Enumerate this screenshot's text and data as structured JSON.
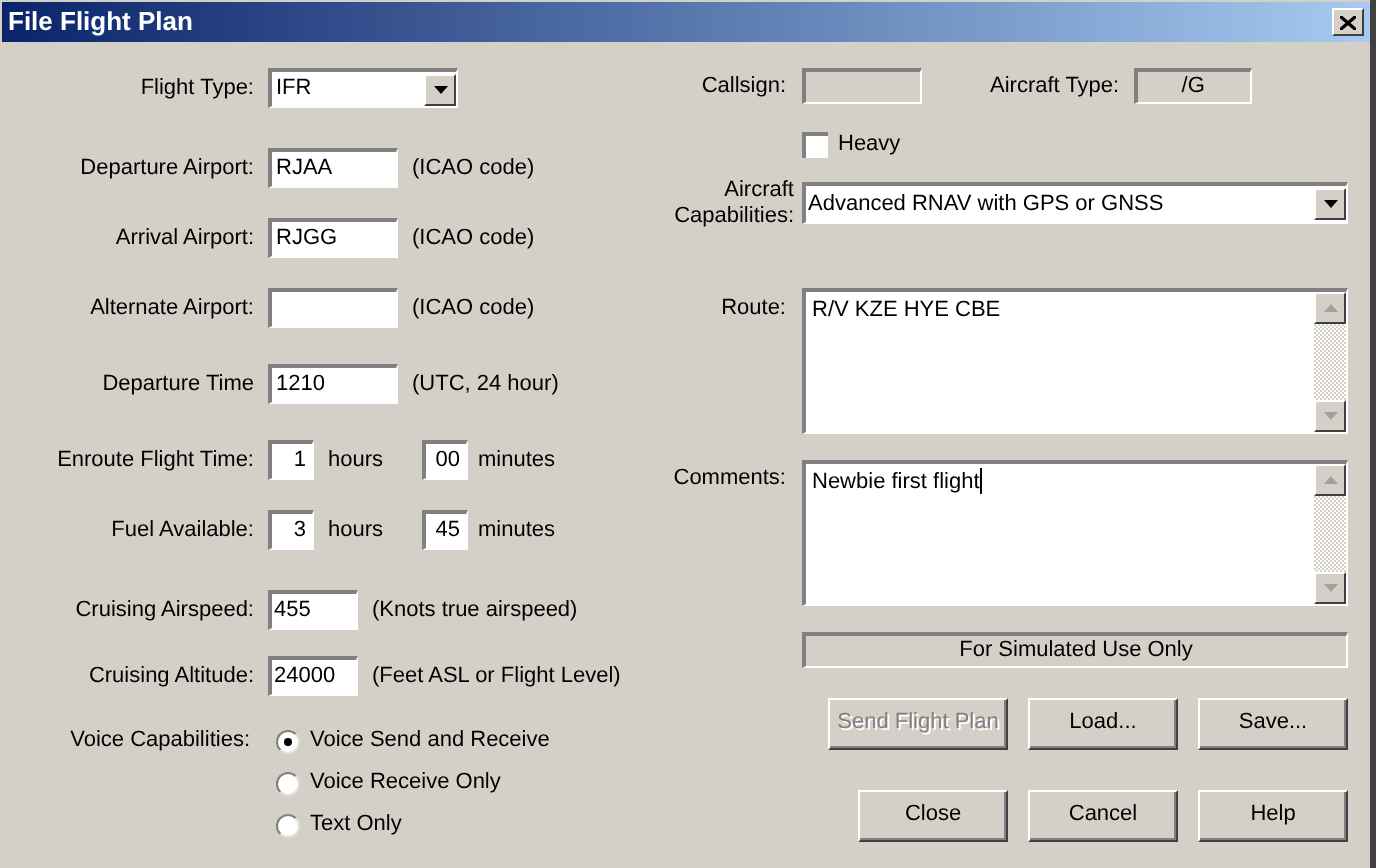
{
  "window": {
    "title": "File Flight Plan"
  },
  "left_fields": [
    {
      "kind": "select",
      "label": "Flight Type:",
      "value": "IFR"
    },
    {
      "kind": "text",
      "label": "Departure Airport:",
      "value": "RJAA",
      "hint": "(ICAO code)"
    },
    {
      "kind": "text",
      "label": "Arrival Airport:",
      "value": "RJGG",
      "hint": "(ICAO code)"
    },
    {
      "kind": "text",
      "label": "Alternate Airport:",
      "hint": "(ICAO code)"
    },
    {
      "kind": "text",
      "label": "Departure Time",
      "value": "1210",
      "hint": "(UTC, 24 hour)"
    },
    {
      "kind": "duration",
      "label": "Enroute Flight Time:",
      "hours": "1",
      "hours_unit": "hours",
      "minutes": "00",
      "minutes_unit": "minutes"
    },
    {
      "kind": "duration",
      "label": "Fuel Available:",
      "hours": "3",
      "hours_unit": "hours",
      "minutes": "45",
      "minutes_unit": "minutes"
    },
    {
      "kind": "short",
      "label": "Cruising Airspeed:",
      "value": "455",
      "hint": "(Knots true airspeed)"
    },
    {
      "kind": "short",
      "label": "Cruising Altitude:",
      "value": "24000",
      "hint": "(Feet ASL or Flight Level)"
    }
  ],
  "voice": {
    "label": "Voice Capabilities:",
    "options": [
      {
        "label": "Voice Send and Receive",
        "selected": true
      },
      {
        "label": "Voice Receive Only",
        "selected": false
      },
      {
        "label": "Text Only",
        "selected": false
      }
    ]
  },
  "callsign": {
    "label": "Callsign:"
  },
  "aircraft_type": {
    "label": "Aircraft Type:",
    "value": "/G"
  },
  "heavy": {
    "label": "Heavy",
    "checked": false
  },
  "capabilities": {
    "label_lines": [
      "Aircraft",
      "Capabilities:"
    ],
    "value": "Advanced RNAV with GPS or GNSS"
  },
  "route": {
    "label": "Route:",
    "value": "R/V KZE HYE CBE"
  },
  "comments": {
    "label": "Comments:",
    "value": "Newbie first flight",
    "caret": true
  },
  "notice": "For Simulated Use Only",
  "button_rows": [
    [
      {
        "label": "Send Flight Plan",
        "disabled": true
      },
      {
        "label": "Load...",
        "disabled": false
      },
      {
        "label": "Save...",
        "disabled": false
      }
    ],
    [
      {
        "label": "Close",
        "disabled": false
      },
      {
        "label": "Cancel",
        "disabled": false
      },
      {
        "label": "Help",
        "disabled": false
      }
    ]
  ]
}
